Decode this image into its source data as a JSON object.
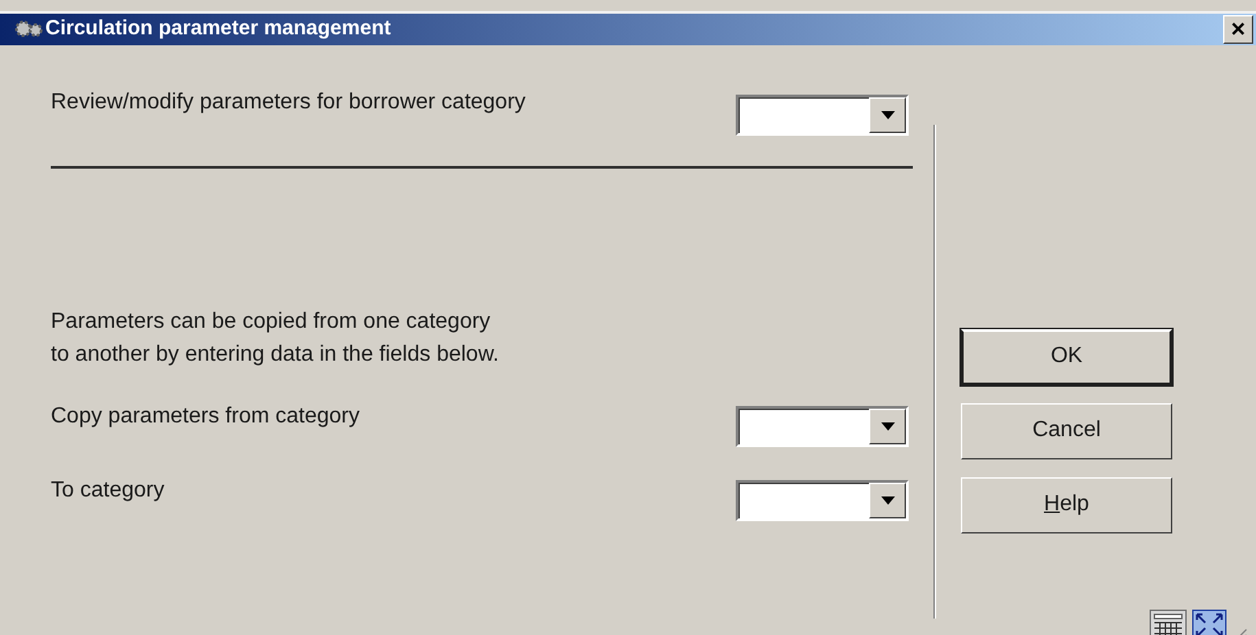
{
  "window": {
    "title": "Circulation parameter management",
    "close": "×"
  },
  "review": {
    "label": "Review/modify parameters for borrower category"
  },
  "info": "Parameters can be copied from one category\nto another by entering data in the fields below.",
  "copy_fields": [
    {
      "label": "Copy parameters from category"
    },
    {
      "label": "To category"
    }
  ],
  "buttons": [
    {
      "label": "OK",
      "default": true,
      "mnemonic": false
    },
    {
      "label": "Cancel",
      "default": false,
      "mnemonic": false
    },
    {
      "label": "Help",
      "default": false,
      "mnemonic": true
    }
  ]
}
